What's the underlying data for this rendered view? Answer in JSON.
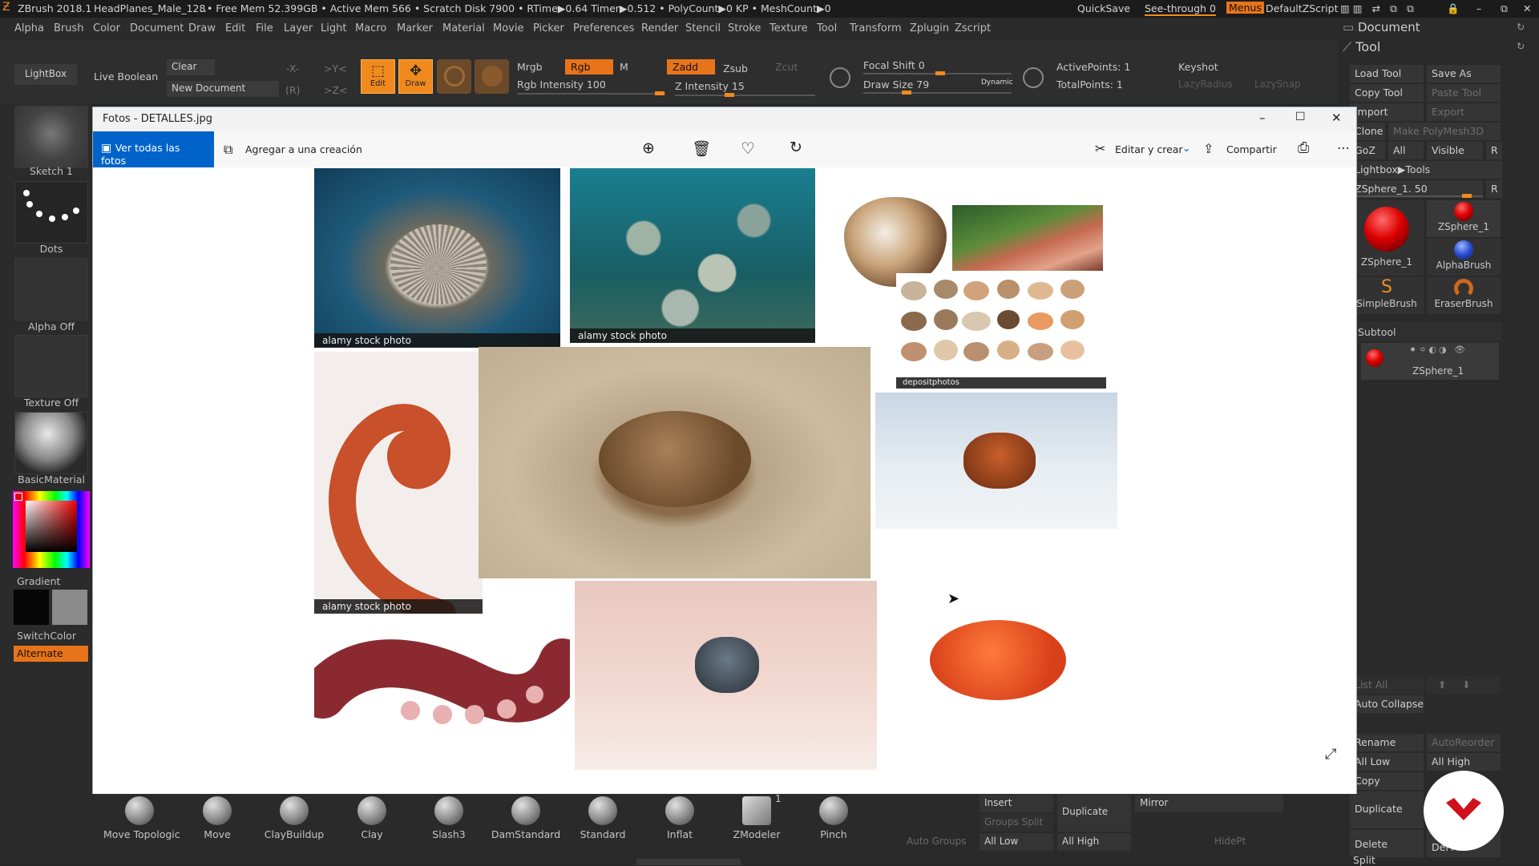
{
  "colors": {
    "accent": "#f08a1d",
    "photos_accent": "#0063c9",
    "bg": "#262626"
  },
  "titlebar": {
    "app": "ZBrush 2018.1",
    "file": "HeadPlanes_Male_128",
    "stats": "..• Free Mem 52.399GB • Active Mem 566 • Scratch Disk 7900 • RTime▶0.64 Timer▶0.512 • PolyCount▶0 KP • MeshCount▶0",
    "quicksave": "QuickSave",
    "see_through": "See-through",
    "see_through_value": "0",
    "menus": "Menus",
    "script": "DefaultZScript"
  },
  "menubar": [
    "Alpha",
    "Brush",
    "Color",
    "Document",
    "Draw",
    "Edit",
    "File",
    "Layer",
    "Light",
    "Macro",
    "Marker",
    "Material",
    "Movie",
    "Picker",
    "Preferences",
    "Render",
    "Stencil",
    "Stroke",
    "Texture",
    "Tool",
    "Transform",
    "Zplugin",
    "Zscript"
  ],
  "toolbar": {
    "lightbox": "LightBox",
    "live_boolean": "Live Boolean",
    "clear": "Clear",
    "new_document": "New Document",
    "x": "-X-",
    "y": ">Y<",
    "z": ">Z<",
    "r": "(R)",
    "edit": "Edit",
    "draw": "Draw",
    "mrgb": "Mrgb",
    "rgb": "Rgb",
    "m": "M",
    "zadd": "Zadd",
    "zsub": "Zsub",
    "zcut": "Zcut",
    "rgb_intensity": "Rgb Intensity 100",
    "z_intensity": "Z Intensity 15",
    "focal_shift": "Focal Shift 0",
    "draw_size": "Draw Size 79",
    "dynamic": "Dynamic",
    "active_points": "ActivePoints: 1",
    "total_points": "TotalPoints: 1",
    "keyshot": "Keyshot",
    "lazy_radius": "LazyRadius",
    "lazy_snap": "LazySnap"
  },
  "leftshelf": {
    "sketch": "Sketch 1",
    "dots": "Dots",
    "alpha": "Alpha Off",
    "texture": "Texture Off",
    "material": "BasicMaterial",
    "gradient": "Gradient",
    "switchcolor": "SwitchColor",
    "alternate": "Alternate"
  },
  "rightpanel": {
    "document": "Document",
    "tool": "Tool",
    "load_tool": "Load Tool",
    "save_as": "Save As",
    "copy_tool": "Copy Tool",
    "paste_tool": "Paste Tool",
    "import": "Import",
    "export": "Export",
    "clone": "Clone",
    "make_polymesh": "Make PolyMesh3D",
    "goz": "GoZ",
    "all": "All",
    "visible": "Visible",
    "r": "R",
    "lightbox_tools": "Lightbox▶Tools",
    "zsphere_slider": "ZSphere_1. 50",
    "tools": [
      "ZSphere_1",
      "ZSphere_1",
      "AlphaBrush",
      "SimpleBrush",
      "EraserBrush"
    ],
    "subtool": "Subtool",
    "subtool_item": "ZSphere_1",
    "list_all": "List All",
    "auto_collapse": "Auto Collapse",
    "rename": "Rename",
    "auto_reorder": "AutoReorder",
    "all_low": "All Low",
    "all_high": "All High",
    "copy": "Copy",
    "duplicate": "Duplicate",
    "delete": "Delete",
    "del_all": "Del All",
    "split": "Split"
  },
  "bottom": {
    "brushes": [
      "Move Topologic",
      "Move",
      "ClayBuildup",
      "Clay",
      "Slash3",
      "DamStandard",
      "Standard",
      "Inflat",
      "ZModeler",
      "Pinch"
    ],
    "zmodeler_count": "1",
    "insert": "Insert",
    "groups_split": "Groups Split",
    "duplicate": "Duplicate",
    "mirror": "Mirror",
    "auto_groups": "Auto Groups",
    "all_low": "All Low",
    "all_high": "All High",
    "hidept": "HidePt"
  },
  "photos": {
    "title": "Fotos - DETALLES.jpg",
    "see_all": "Ver todas las fotos",
    "add_to": "Agregar a una creación",
    "edit_create": "Editar y crear",
    "share": "Compartir",
    "watermarks": [
      "alamy stock photo",
      "alamy stock photo",
      "alamy stock photo",
      "depositphotos"
    ]
  }
}
